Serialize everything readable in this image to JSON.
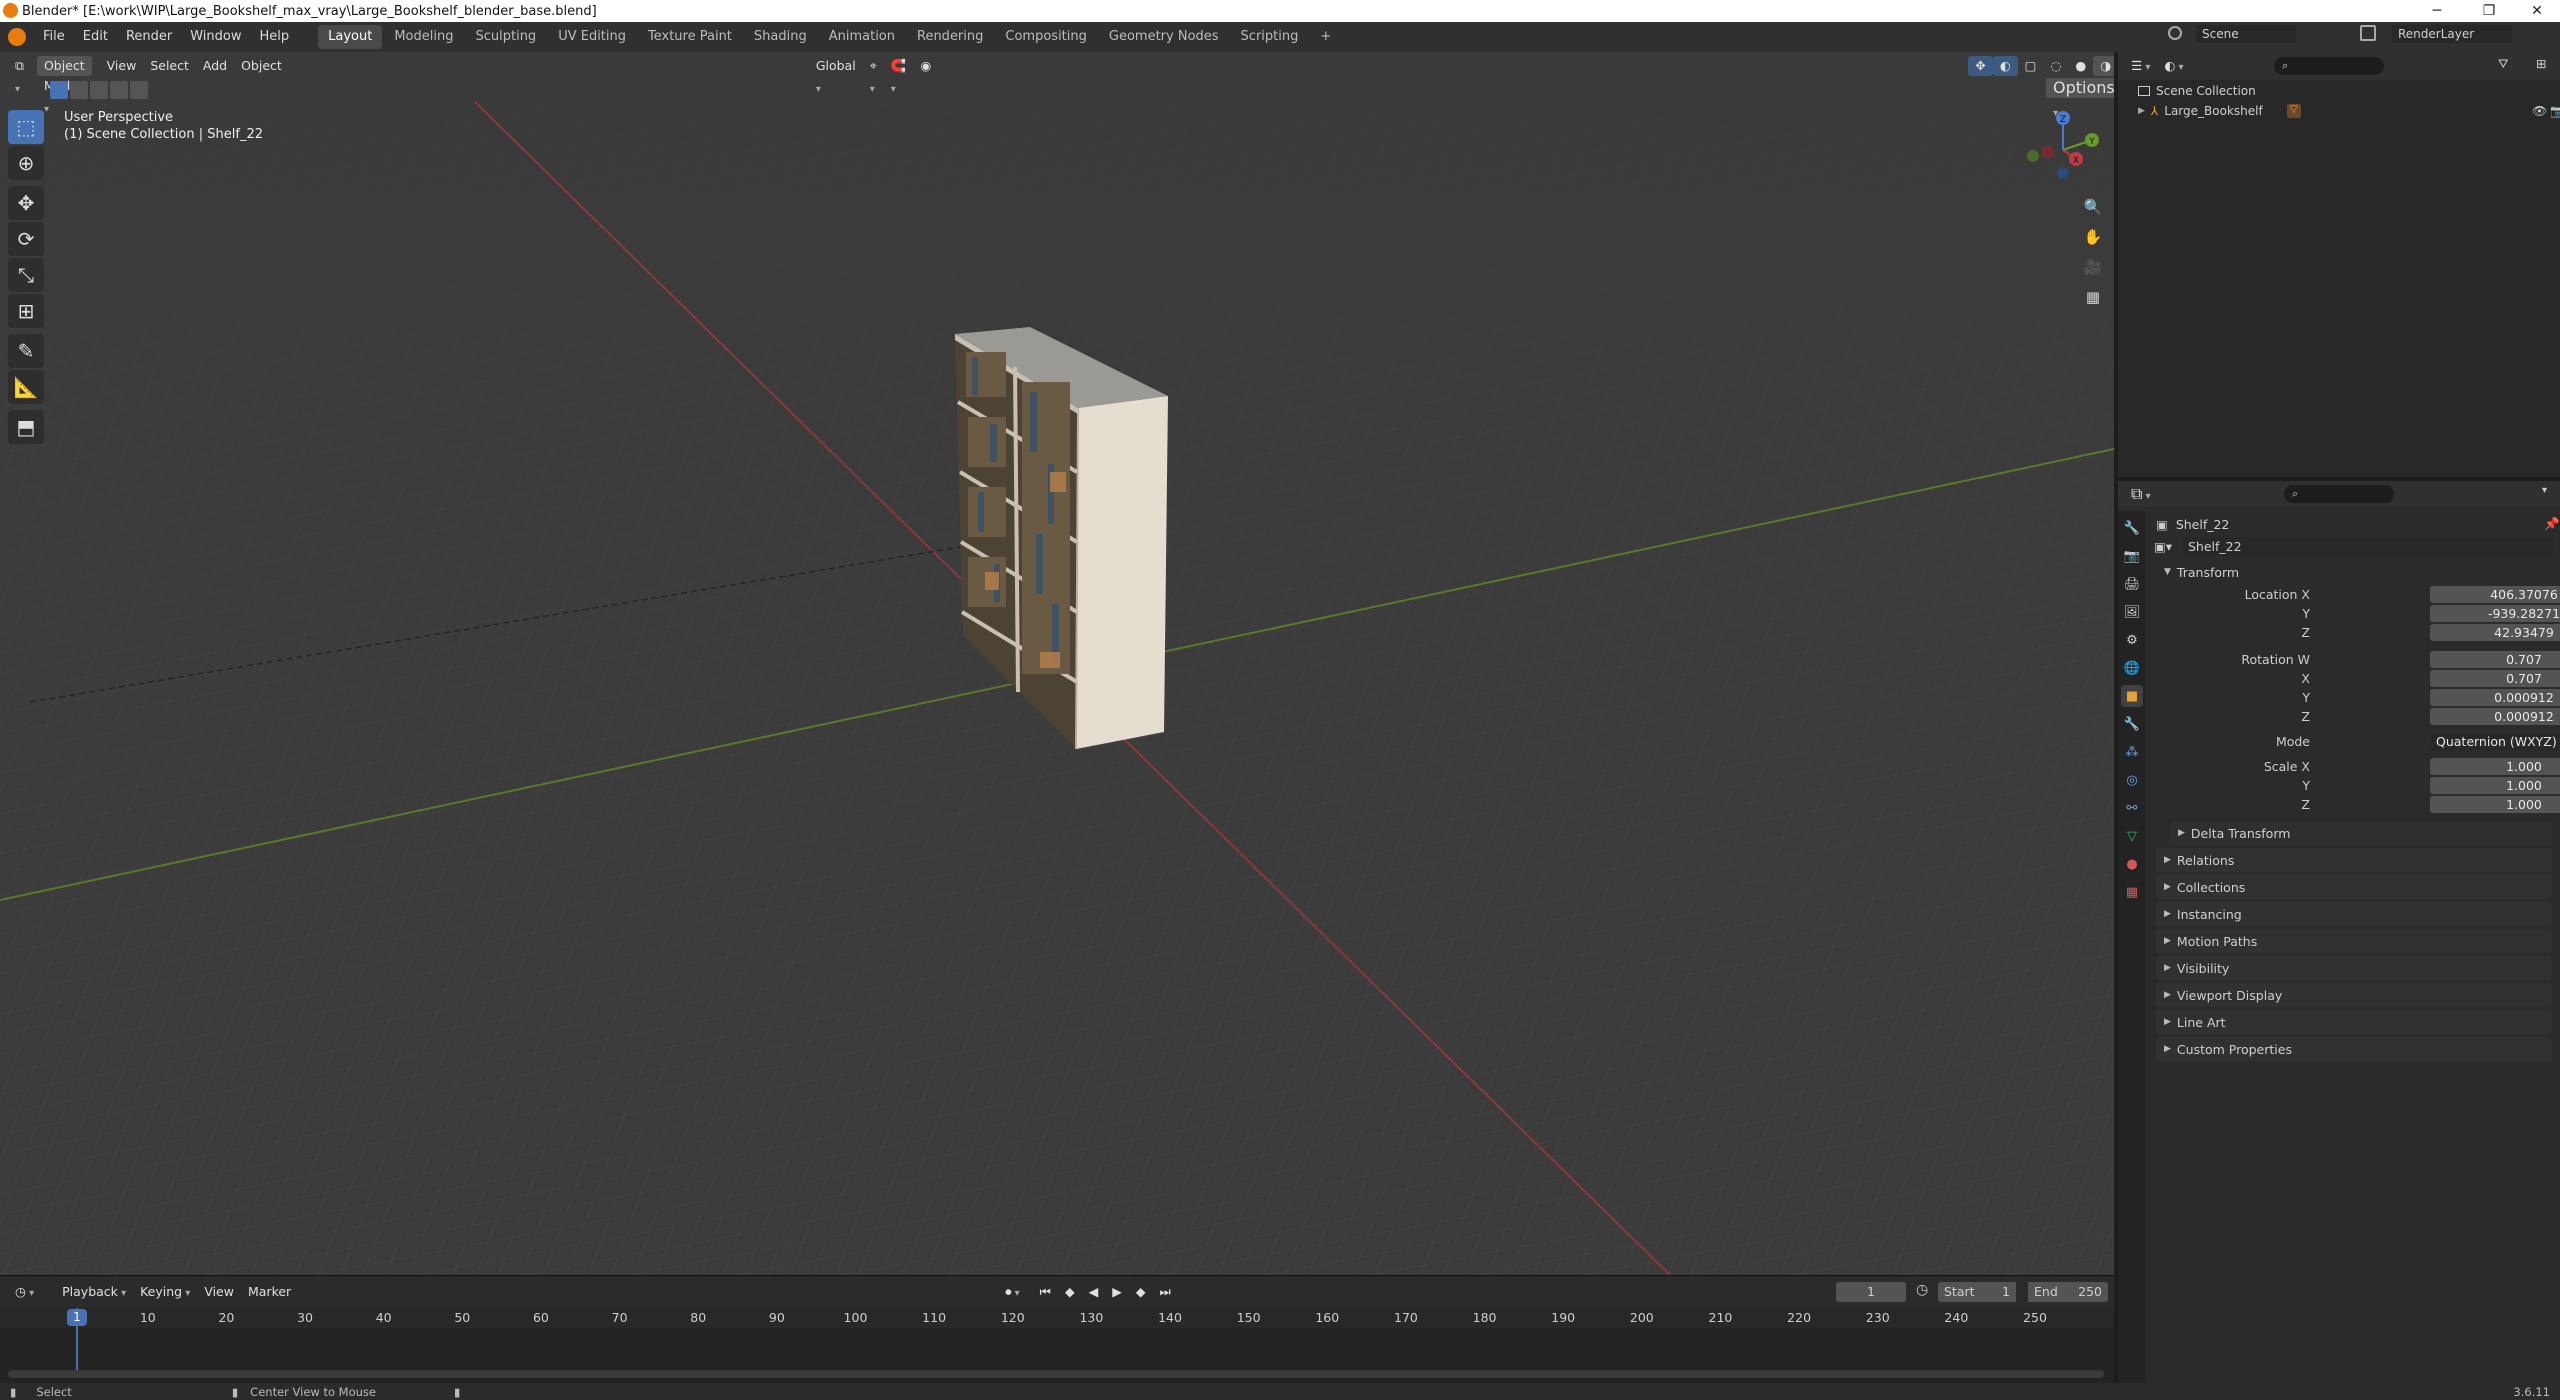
{
  "window": {
    "title": "Blender* [E:\\work\\WIP\\Large_Bookshelf_max_vray\\Large_Bookshelf_blender_base.blend]",
    "minimize": "─",
    "maximize": "❐",
    "close": "✕"
  },
  "menu": [
    "File",
    "Edit",
    "Render",
    "Window",
    "Help"
  ],
  "workspaces": [
    "Layout",
    "Modeling",
    "Sculpting",
    "UV Editing",
    "Texture Paint",
    "Shading",
    "Animation",
    "Rendering",
    "Compositing",
    "Geometry Nodes",
    "Scripting",
    "+"
  ],
  "scene": {
    "name": "Scene",
    "render_layer": "RenderLayer"
  },
  "viewport": {
    "mode": "Object Mode",
    "menus": [
      "View",
      "Select",
      "Add",
      "Object"
    ],
    "transform_orientation": "Global",
    "options": "Options",
    "perspective": "User Perspective",
    "collection_info": "(1) Scene Collection | Shelf_22",
    "gizmo": {
      "x": "X",
      "y": "Y",
      "z": "Z"
    }
  },
  "outliner": {
    "root": "Scene Collection",
    "items": [
      "Large_Bookshelf"
    ]
  },
  "properties": {
    "object_name": "Shelf_22",
    "data_name": "Shelf_22",
    "transform_label": "Transform",
    "location": {
      "label": "Location X",
      "x": "406.37076",
      "y": "-939.28271",
      "z": "42.93479"
    },
    "rotation": {
      "label": "Rotation W",
      "w": "0.707",
      "x": "0.707",
      "y": "0.000912",
      "z": "0.000912"
    },
    "mode_label": "Mode",
    "mode_value": "Quaternion (WXYZ)",
    "scale": {
      "label": "Scale X",
      "x": "1.000",
      "y": "1.000",
      "z": "1.000"
    },
    "axis_labels": {
      "x": "X",
      "y": "Y",
      "z": "Z"
    },
    "delta": "Delta Transform",
    "sections": [
      "Relations",
      "Collections",
      "Instancing",
      "Motion Paths",
      "Visibility",
      "Viewport Display",
      "Line Art",
      "Custom Properties"
    ]
  },
  "timeline": {
    "menus": [
      "Playback",
      "Keying",
      "View",
      "Marker"
    ],
    "current_frame": "1",
    "start_label": "Start",
    "start": "1",
    "end_label": "End",
    "end": "250",
    "ticks": [
      "1",
      "10",
      "20",
      "30",
      "40",
      "50",
      "60",
      "70",
      "80",
      "90",
      "100",
      "110",
      "120",
      "130",
      "140",
      "150",
      "160",
      "170",
      "180",
      "190",
      "200",
      "210",
      "220",
      "230",
      "240",
      "250"
    ]
  },
  "status": {
    "select": "Select",
    "center_view": "Center View to Mouse",
    "version": "3.6.11"
  }
}
